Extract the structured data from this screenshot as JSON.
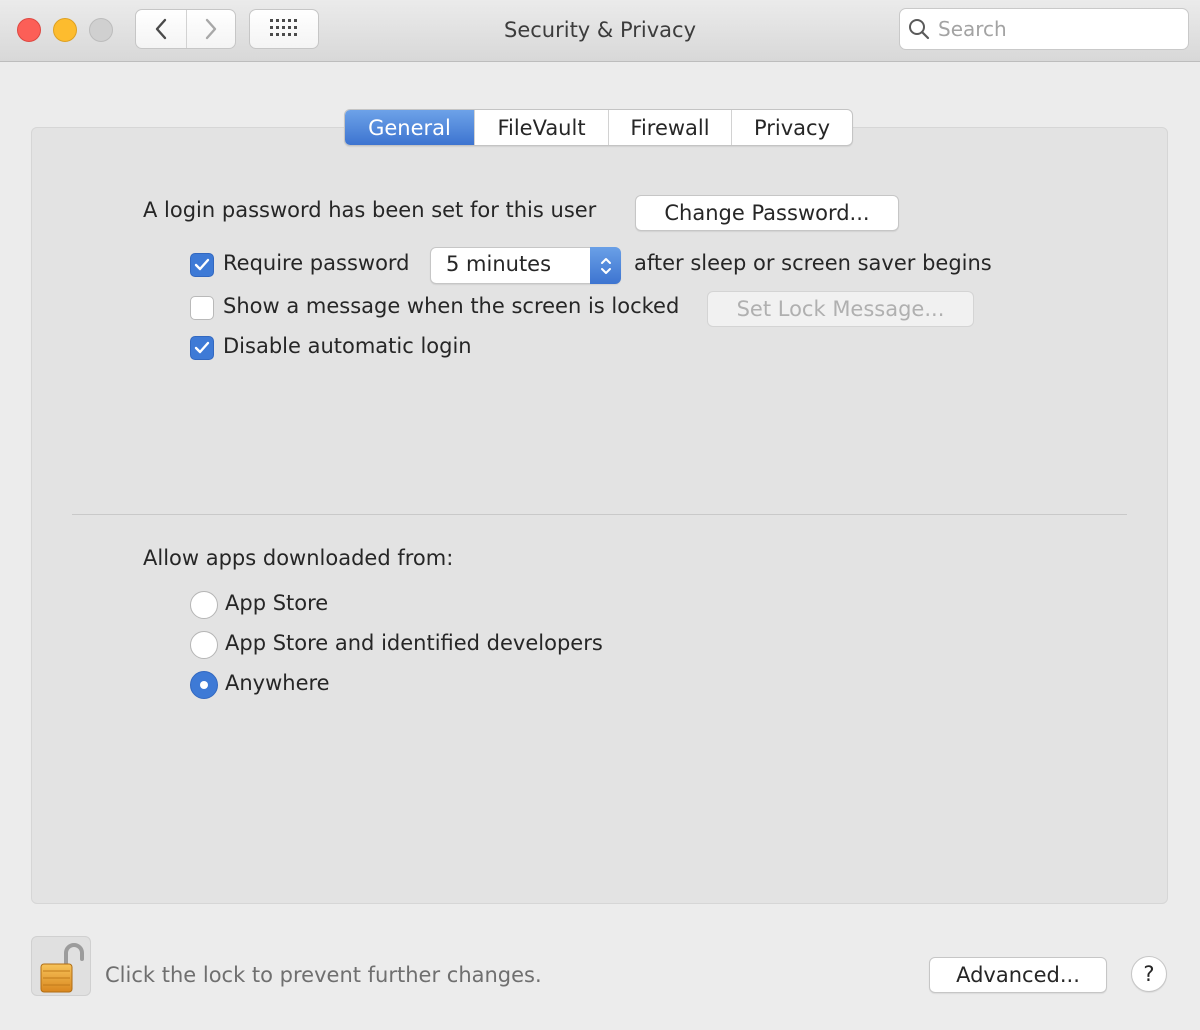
{
  "window": {
    "title": "Security & Privacy"
  },
  "search": {
    "placeholder": "Search",
    "value": ""
  },
  "tabs": [
    {
      "label": "General",
      "active": true
    },
    {
      "label": "FileVault",
      "active": false
    },
    {
      "label": "Firewall",
      "active": false
    },
    {
      "label": "Privacy",
      "active": false
    }
  ],
  "general": {
    "login_text": "A login password has been set for this user",
    "change_password_label": "Change Password...",
    "require_password": {
      "label": "Require password",
      "checked": true
    },
    "delay_select": {
      "value": "5 minutes"
    },
    "after_text": "after sleep or screen saver begins",
    "show_message": {
      "label": "Show a message when the screen is locked",
      "checked": false
    },
    "set_lock_message_label": "Set Lock Message...",
    "disable_auto_login": {
      "label": "Disable automatic login",
      "checked": true
    }
  },
  "downloads": {
    "heading": "Allow apps downloaded from:",
    "options": [
      {
        "label": "App Store",
        "selected": false
      },
      {
        "label": "App Store and identified developers",
        "selected": false
      },
      {
        "label": "Anywhere",
        "selected": true
      }
    ]
  },
  "footer": {
    "lock_text": "Click the lock to prevent further changes.",
    "advanced_label": "Advanced...",
    "help_label": "?"
  },
  "colors": {
    "accent": "#3e7ad6",
    "close": "#fc5f57",
    "minimize": "#fdbc2e",
    "zoom": "#d0d0d0"
  }
}
